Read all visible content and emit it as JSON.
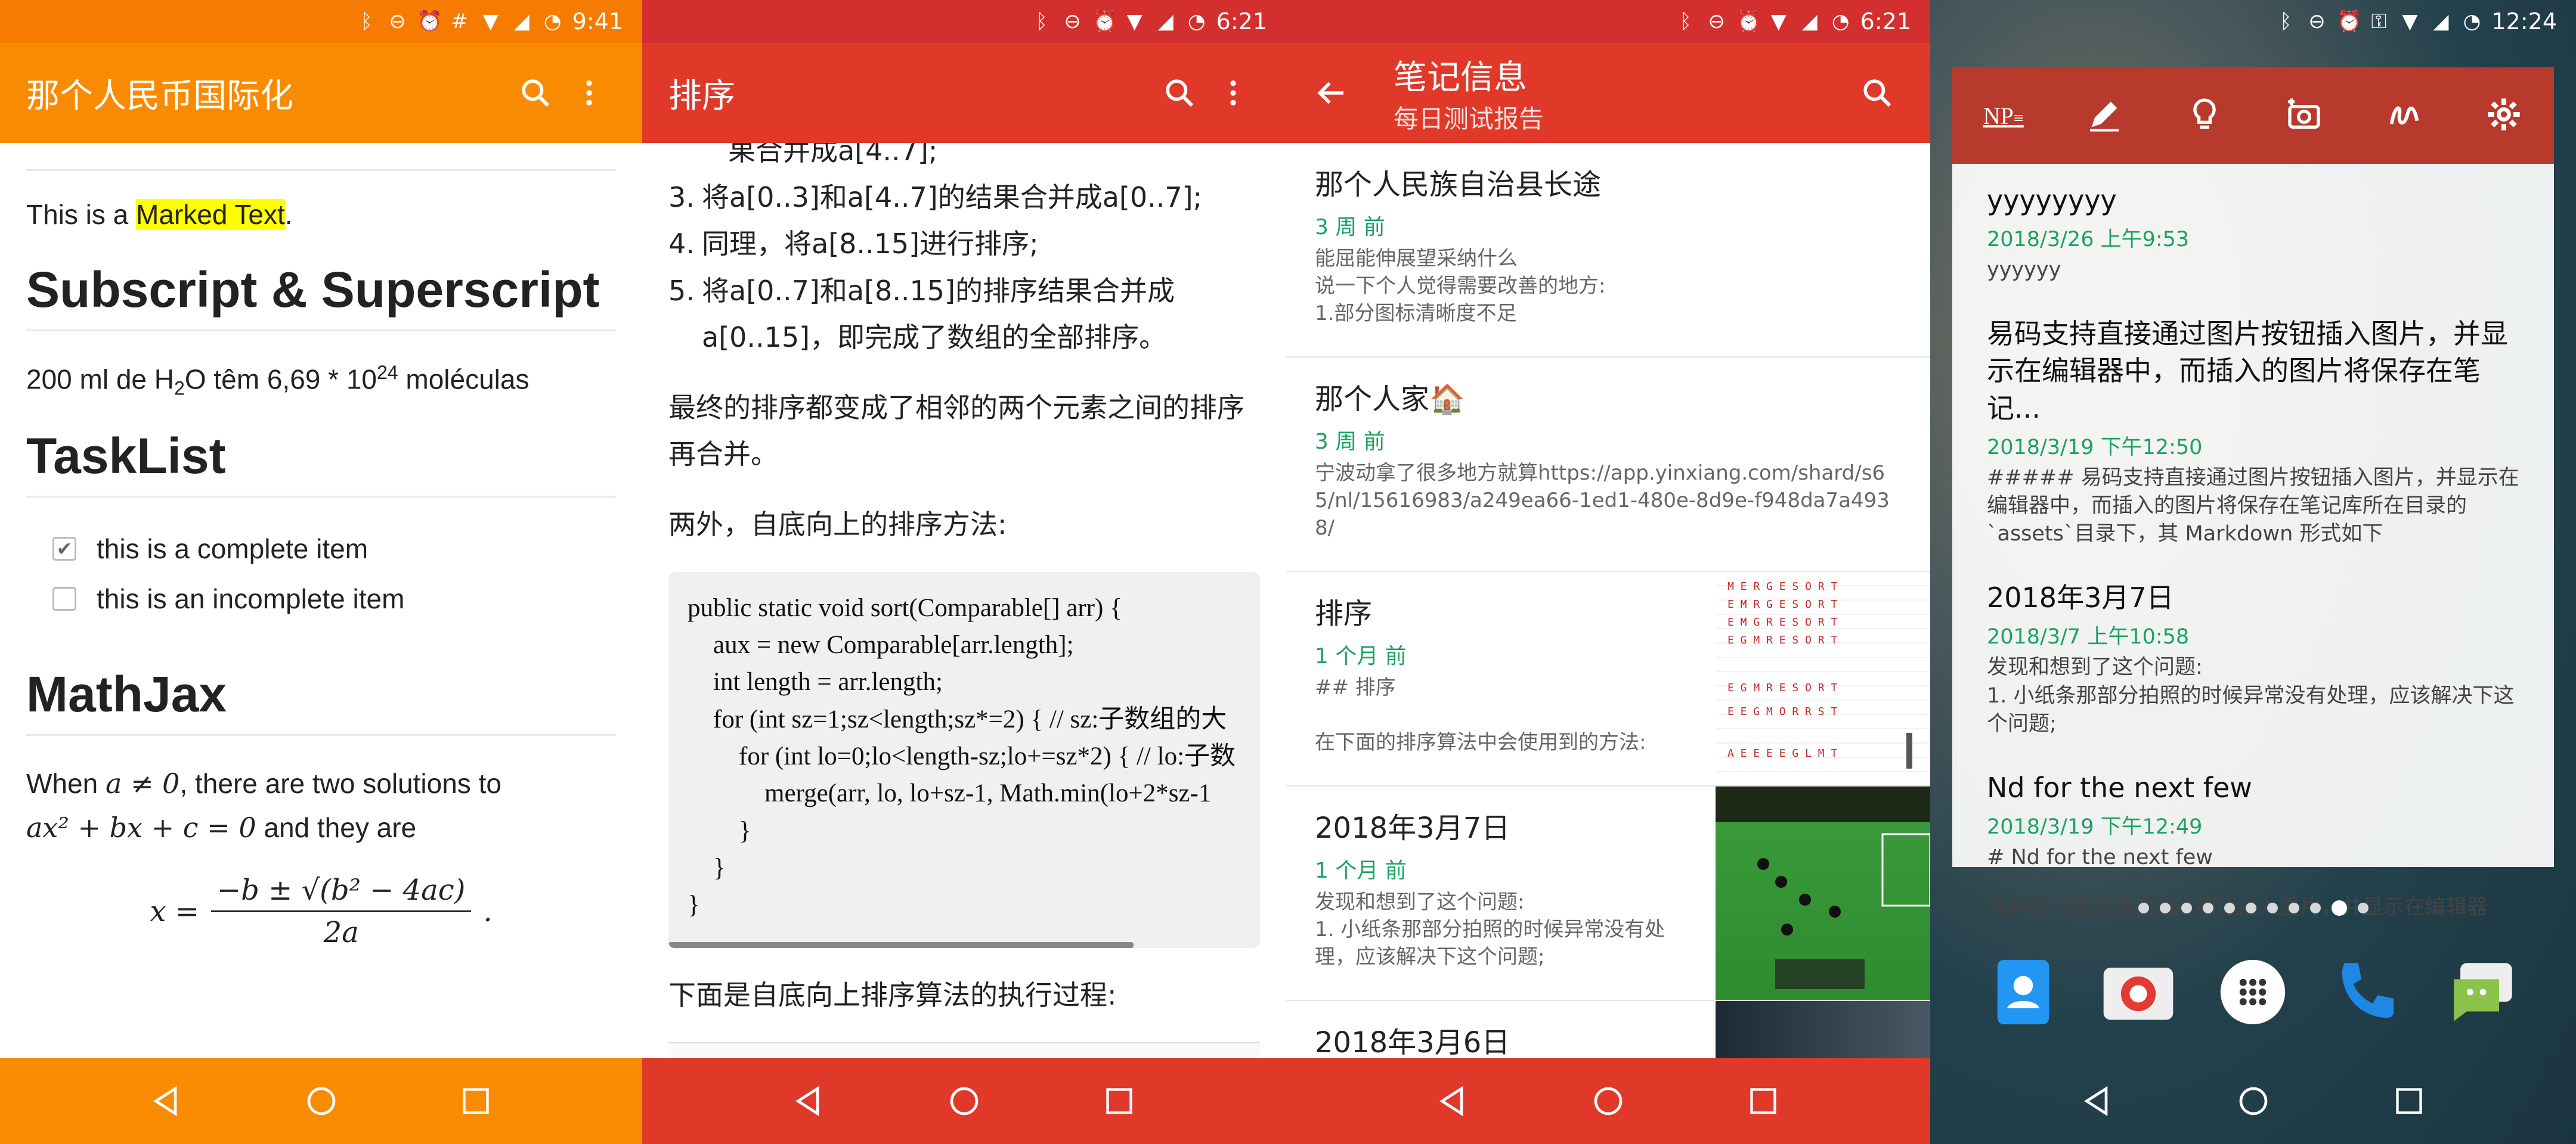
{
  "phone1": {
    "status": {
      "time": "9:41"
    },
    "appbar": {
      "title": "那个人民币国际化"
    },
    "content": {
      "marked_prefix": "This is a ",
      "marked_text": "Marked Text",
      "marked_suffix": ".",
      "h_sub": "Subscript & Superscript",
      "sub_line": {
        "a": "200 ml de H",
        "sub": "2",
        "b": "O têm 6,69 * 10",
        "sup": "24",
        "c": " moléculas"
      },
      "h_task": "TaskList",
      "tasks": [
        {
          "label": "this is a complete item",
          "checked": true
        },
        {
          "label": "this is an incomplete item",
          "checked": false
        }
      ],
      "h_math": "MathJax",
      "math_intro_a": "When ",
      "math_cond": "a ≠ 0",
      "math_intro_b": ", there are two solutions to",
      "math_eq": "ax² + bx + c = 0",
      "math_intro_c": " and they are",
      "formula_lhs": "x =",
      "formula_num": "−b ± √(b² − 4ac)",
      "formula_den": "2a"
    }
  },
  "phone2": {
    "status": {
      "time": "6:21"
    },
    "appbar": {
      "title": "排序"
    },
    "content": {
      "cut_line": "果合并成a[4..7];",
      "list": [
        {
          "num": "3.",
          "text": "将a[0..3]和a[4..7]的结果合并成a[0..7];"
        },
        {
          "num": "4.",
          "text": "同理，将a[8..15]进行排序;"
        },
        {
          "num": "5.",
          "text": "将a[0..7]和a[8..15]的排序结果合并成a[0..15]，即完成了数组的全部排序。"
        }
      ],
      "para1": "最终的排序都变成了相邻的两个元素之间的排序再合并。",
      "para2": "两外，自底向上的排序方法:",
      "code": "public static void sort(Comparable[] arr) {\n    aux = new Comparable[arr.length];\n    int length = arr.length;\n    for (int sz=1;sz<length;sz*=2) { // sz:子数组的大\n        for (int lo=0;lo<length-sz;lo+=sz*2) { // lo:子数\n            merge(arr, lo, lo+sz-1, Math.min(lo+2*sz-1\n        }\n    }\n}",
      "para3": "下面是自底向上排序算法的执行过程:"
    }
  },
  "phone3": {
    "status": {
      "time": "6:21"
    },
    "appbar": {
      "title": "笔记信息",
      "subtitle": "每日测试报告"
    },
    "notes": [
      {
        "title": "那个人民族自治县长途",
        "date": "3 周 前",
        "summary": "能屈能伸展望采纳什么\n说一下个人觉得需要改善的地方:\n1.部分图标清晰度不足",
        "thumb": ""
      },
      {
        "title": "那个人家🏠",
        "date": "3 周 前",
        "summary": "宁波动拿了很多地方就算https://app.yinxiang.com/shard/s65/nl/15616983/a249ea66-1ed1-480e-8d9e-f948da7a4938/",
        "thumb": ""
      },
      {
        "title": "排序",
        "date": "1 个月 前",
        "summary": "## 排序\n\n在下面的排序算法中会使用到的方法:",
        "thumb": "table"
      },
      {
        "title": "2018年3月7日",
        "date": "1 个月 前",
        "summary": "发现和想到了这个问题:\n1. 小纸条那部分拍照的时候异常没有处理，应该解决下这个问题;",
        "thumb": "game"
      },
      {
        "title": "2018年3月6日",
        "date": "",
        "summary": "",
        "thumb": "photo"
      }
    ]
  },
  "phone4": {
    "status": {
      "time": "12:24"
    },
    "widget_logo": "NP",
    "notes": [
      {
        "title": "yyyyyyyy",
        "date": "2018/3/26 上午9:53",
        "summary": "yyyyyy"
      },
      {
        "title": "易码支持直接通过图片按钮插入图片，并显示在编辑器中，而插入的图片将保存在笔记...",
        "date": "2018/3/19 下午12:50",
        "summary": "##### 易码支持直接通过图片按钮插入图片，并显示在编辑器中，而插入的图片将保存在笔记库所在目录的`assets`目录下，其 Markdown 形式如下"
      },
      {
        "title": "2018年3月7日",
        "date": "2018/3/7 上午10:58",
        "summary": "发现和想到了这个问题:\n1. 小纸条那部分拍照的时候异常没有处理，应该解决下这个问题;"
      },
      {
        "title": "Nd for the next few",
        "date": "2018/3/19 下午12:49",
        "summary": "# Nd for the next few"
      }
    ],
    "footer_text": "易码支持直接通过图片按钮插入图片，并显示在编辑器",
    "colors": {
      "orange": "#f98b02",
      "red": "#e0392a",
      "green_date": "#1aa260"
    }
  }
}
